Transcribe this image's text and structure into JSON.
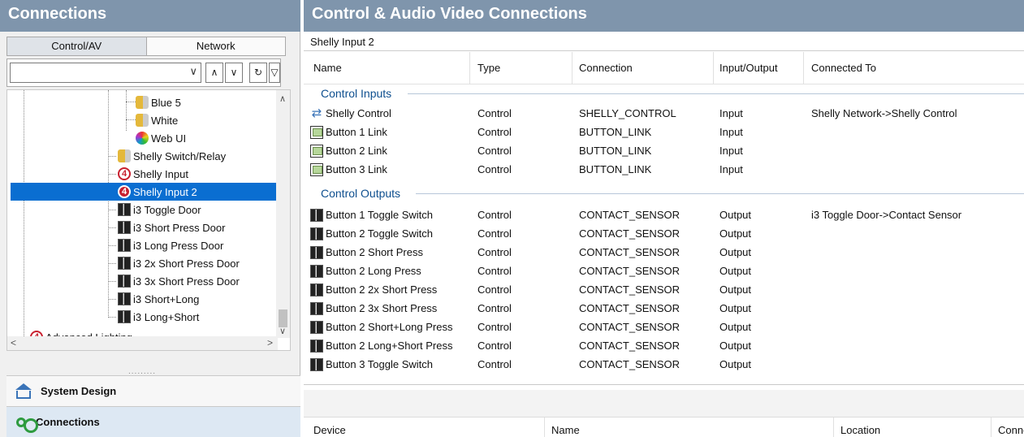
{
  "left_panel": {
    "title": "Connections",
    "tabs": [
      "Control/AV",
      "Network"
    ],
    "tree": [
      {
        "label": "Blue 5",
        "icon": "bulb-icon"
      },
      {
        "label": "White",
        "icon": "bulb-icon"
      },
      {
        "label": "Web UI",
        "icon": "color-wheel-icon"
      },
      {
        "label": "Shelly Switch/Relay",
        "icon": "bulb-icon"
      },
      {
        "label": "Shelly Input",
        "icon": "four-logo-icon"
      },
      {
        "label": "Shelly Input 2",
        "icon": "four-logo-icon",
        "selected": true
      },
      {
        "label": "i3 Toggle Door",
        "icon": "door-icon"
      },
      {
        "label": "i3 Short Press Door",
        "icon": "door-icon"
      },
      {
        "label": "i3 Long Press Door",
        "icon": "door-icon"
      },
      {
        "label": "i3 2x Short Press Door",
        "icon": "door-icon"
      },
      {
        "label": "i3 3x Short Press Door",
        "icon": "door-icon"
      },
      {
        "label": "i3 Short+Long",
        "icon": "door-icon"
      },
      {
        "label": "i3 Long+Short",
        "icon": "door-icon"
      },
      {
        "label": "Advanced Lighting",
        "icon": "four-logo-icon"
      }
    ],
    "nav": {
      "system_design": "System Design",
      "connections": "Connections"
    }
  },
  "right_panel": {
    "title": "Control & Audio Video Connections",
    "device_name": "Shelly Input 2",
    "columns": [
      "Name",
      "Type",
      "Connection",
      "Input/Output",
      "Connected To"
    ],
    "groups": {
      "inputs_label": "Control Inputs",
      "outputs_label": "Control Outputs"
    },
    "inputs": [
      {
        "name": "Shelly Control",
        "type": "Control",
        "connection": "SHELLY_CONTROL",
        "io": "Input",
        "connected_to": "Shelly Network->Shelly Control",
        "icon": "shelly-control-icon"
      },
      {
        "name": "Button 1 Link",
        "type": "Control",
        "connection": "BUTTON_LINK",
        "io": "Input",
        "connected_to": "",
        "icon": "button-link-icon"
      },
      {
        "name": "Button 2 Link",
        "type": "Control",
        "connection": "BUTTON_LINK",
        "io": "Input",
        "connected_to": "",
        "icon": "button-link-icon"
      },
      {
        "name": "Button 3 Link",
        "type": "Control",
        "connection": "BUTTON_LINK",
        "io": "Input",
        "connected_to": "",
        "icon": "button-link-icon"
      }
    ],
    "outputs": [
      {
        "name": "Button 1 Toggle Switch",
        "type": "Control",
        "connection": "CONTACT_SENSOR",
        "io": "Output",
        "connected_to": "i3 Toggle Door->Contact Sensor"
      },
      {
        "name": "Button 2 Toggle Switch",
        "type": "Control",
        "connection": "CONTACT_SENSOR",
        "io": "Output",
        "connected_to": ""
      },
      {
        "name": "Button 2 Short Press",
        "type": "Control",
        "connection": "CONTACT_SENSOR",
        "io": "Output",
        "connected_to": ""
      },
      {
        "name": "Button 2 Long Press",
        "type": "Control",
        "connection": "CONTACT_SENSOR",
        "io": "Output",
        "connected_to": ""
      },
      {
        "name": "Button 2 2x Short Press",
        "type": "Control",
        "connection": "CONTACT_SENSOR",
        "io": "Output",
        "connected_to": ""
      },
      {
        "name": "Button 2 3x Short Press",
        "type": "Control",
        "connection": "CONTACT_SENSOR",
        "io": "Output",
        "connected_to": ""
      },
      {
        "name": "Button 2 Short+Long Press",
        "type": "Control",
        "connection": "CONTACT_SENSOR",
        "io": "Output",
        "connected_to": ""
      },
      {
        "name": "Button 2 Long+Short Press",
        "type": "Control",
        "connection": "CONTACT_SENSOR",
        "io": "Output",
        "connected_to": ""
      },
      {
        "name": "Button 3 Toggle Switch",
        "type": "Control",
        "connection": "CONTACT_SENSOR",
        "io": "Output",
        "connected_to": ""
      }
    ],
    "bottom_columns": [
      "Device",
      "Name",
      "Location",
      "Conne"
    ]
  },
  "colors": {
    "title_bar": "#7f95ac",
    "selection": "#0a6ed1",
    "group_text": "#0e4f8f"
  }
}
